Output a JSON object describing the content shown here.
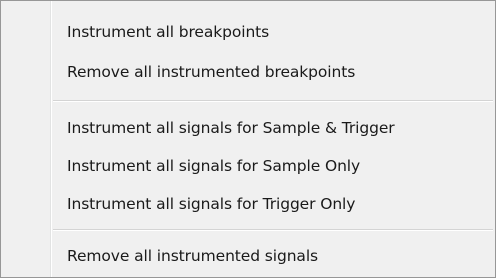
{
  "menu": {
    "items": [
      {
        "label": "Instrument all breakpoints"
      },
      {
        "label": "Remove all instrumented breakpoints"
      },
      {
        "label": "Instrument all signals for Sample & Trigger"
      },
      {
        "label": "Instrument all signals for Sample Only"
      },
      {
        "label": "Instrument all signals for Trigger Only"
      },
      {
        "label": "Remove all instrumented signals"
      }
    ]
  }
}
